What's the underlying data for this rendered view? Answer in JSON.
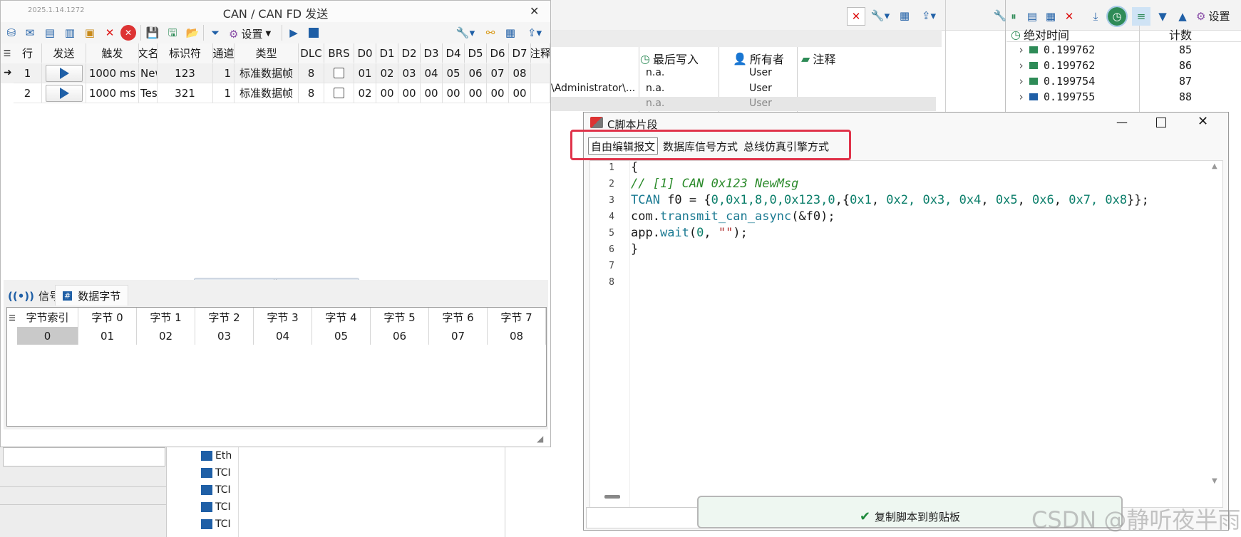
{
  "colors": {
    "accent": "#1f5fa6",
    "highlight_box": "#e0334a",
    "toast_bg": "#eef7f1",
    "check": "#1e8a3c"
  },
  "send_window": {
    "version": "2025.1.14.1272",
    "title": "CAN / CAN FD 发送",
    "close": "✕",
    "toolbar": {
      "settings_label": "设置"
    },
    "columns": [
      "行",
      "发送",
      "触发",
      "文名",
      "标识符",
      "通道",
      "类型",
      "DLC",
      "BRS",
      "D0",
      "D1",
      "D2",
      "D3",
      "D4",
      "D5",
      "D6",
      "D7",
      "注释"
    ],
    "rows": [
      {
        "row": "1",
        "trigger": "1000 ms",
        "name": "New",
        "id": "123",
        "channel": "1",
        "type": "标准数据帧",
        "dlc": "8",
        "brs": false,
        "d": [
          "01",
          "02",
          "03",
          "04",
          "05",
          "06",
          "07",
          "08"
        ]
      },
      {
        "row": "2",
        "trigger": "1000 ms",
        "name": "Tes",
        "id": "321",
        "channel": "1",
        "type": "标准数据帧",
        "dlc": "8",
        "brs": false,
        "d": [
          "02",
          "00",
          "00",
          "00",
          "00",
          "00",
          "00",
          "00"
        ]
      }
    ],
    "bottom_tabs": {
      "signal": "信号",
      "data_bytes": "数据字节"
    },
    "byte_table": {
      "headers": [
        "字节索引",
        "字节 0",
        "字节 1",
        "字节 2",
        "字节 3",
        "字节 4",
        "字节 5",
        "字节 6",
        "字节 7"
      ],
      "values": [
        "0",
        "01",
        "02",
        "03",
        "04",
        "05",
        "06",
        "07",
        "08"
      ]
    }
  },
  "background": {
    "table_headers": {
      "last_write": "最后写入",
      "owner": "所有者",
      "comment": "注释"
    },
    "rows": [
      {
        "path": "",
        "last_write": "n.a.",
        "owner": "User"
      },
      {
        "path": "\\Administrator\\...",
        "last_write": "n.a.",
        "owner": "User"
      },
      {
        "path": "",
        "last_write": "n.a.",
        "owner": "User"
      }
    ],
    "tree_items": [
      "Eth",
      "TCI",
      "TCI",
      "TCI",
      "TCI"
    ],
    "right_panel": {
      "settings_label": "设置",
      "col_time": "绝对时间",
      "col_count": "计数",
      "rows": [
        {
          "time": "0.199762",
          "count": "85"
        },
        {
          "time": "0.199762",
          "count": "86"
        },
        {
          "time": "0.199754",
          "count": "87"
        },
        {
          "time": "0.199755",
          "count": "88"
        }
      ]
    }
  },
  "script_dialog": {
    "title": "C脚本片段",
    "tabs": [
      "自由编辑报文",
      "数据库信号方式",
      "总线仿真引擎方式"
    ],
    "line_numbers": [
      "1",
      "2",
      "3",
      "4",
      "5",
      "6",
      "7",
      "8"
    ],
    "copy_button": "复制脚本到剪贴板"
  },
  "watermark": "CSDN @静听夜半雨"
}
